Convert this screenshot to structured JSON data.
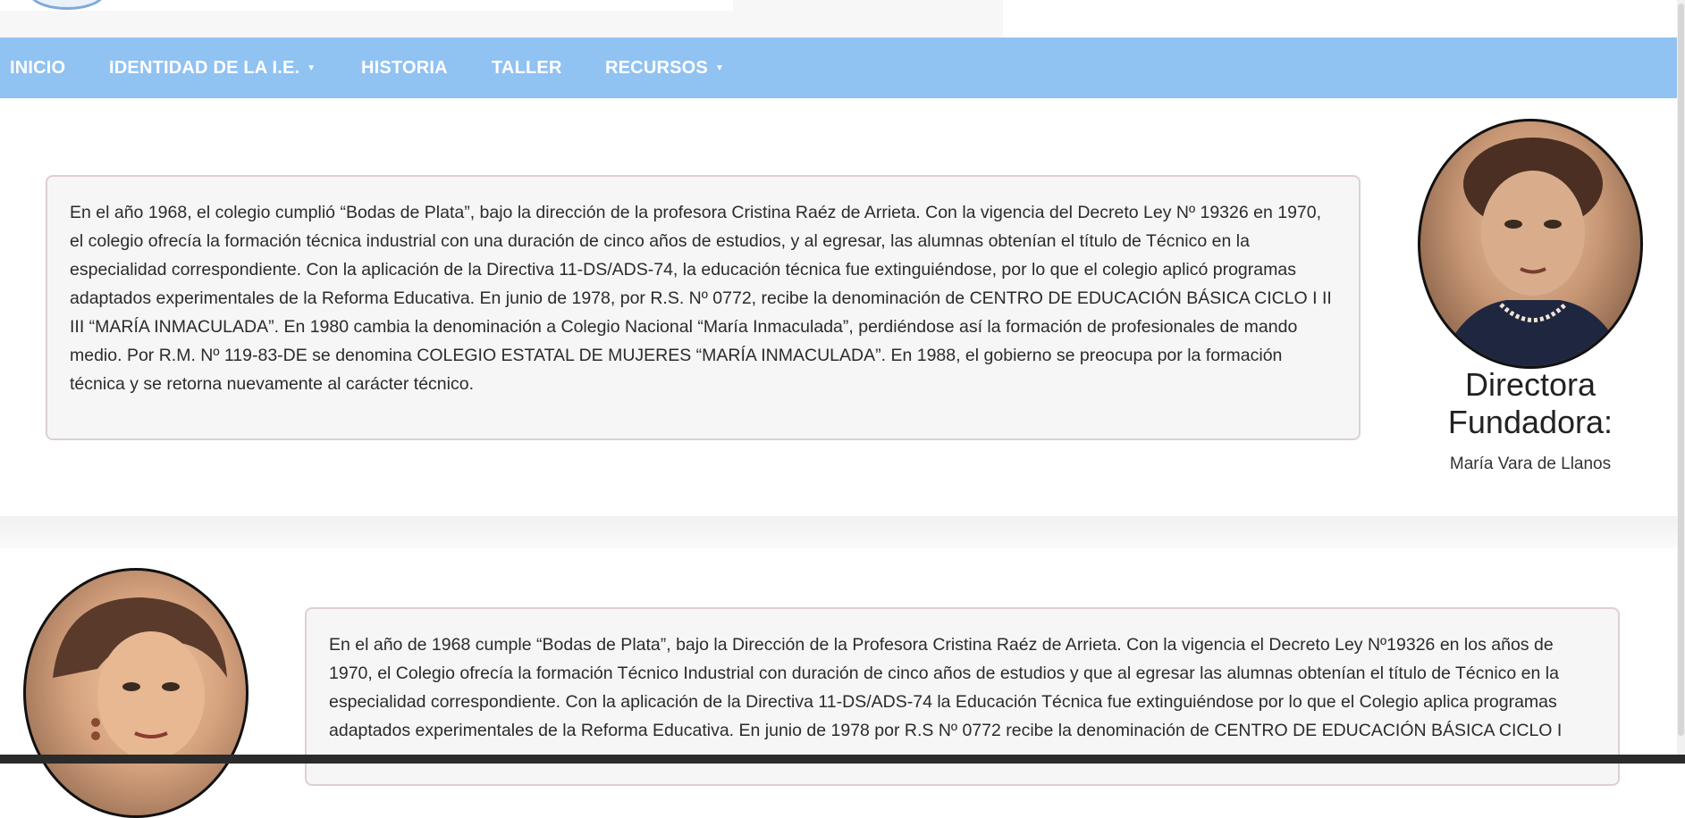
{
  "nav": {
    "items": [
      {
        "label": "INICIO"
      },
      {
        "label": "IDENTIDAD DE LA I.E."
      },
      {
        "label": "HISTORIA"
      },
      {
        "label": "TALLER"
      },
      {
        "label": "RECURSOS"
      }
    ],
    "caret": "▼"
  },
  "section1": {
    "paragraph": "En el año 1968, el colegio cumplió “Bodas de Plata”, bajo la dirección de la profesora Cristina Raéz de Arrieta. Con la vigencia del Decreto Ley Nº 19326 en 1970, el colegio ofrecía la formación técnica industrial con una duración de cinco años de estudios, y al egresar, las alumnas obtenían el título de Técnico en la especialidad correspondiente. Con la aplicación de la Directiva 11-DS/ADS-74, la educación técnica fue extinguiéndose, por lo que el colegio aplicó programas adaptados experimentales de la Reforma Educativa. En junio de 1978, por R.S. Nº 0772, recibe la denominación de CENTRO DE EDUCACIÓN BÁSICA CICLO I II III “MARÍA INMACULADA”. En 1980 cambia la denominación a Colegio Nacional “María Inmaculada”, perdiéndose así la formación de profesionales de mando medio. Por R.M. Nº 119-83-DE se denomina COLEGIO ESTATAL DE MUJERES “MARÍA INMACULADA”. En 1988, el gobierno se preocupa por la formación técnica y se retorna nuevamente al carácter técnico.",
    "portrait_title": "Directora Fundadora:",
    "portrait_name": "María Vara de Llanos"
  },
  "section2": {
    "paragraph": "En el año de 1968 cumple “Bodas de Plata”, bajo la Dirección de la Profesora Cristina Raéz de Arrieta. Con la vigencia el Decreto Ley Nº19326 en los años de 1970, el Colegio ofrecía la formación Técnico Industrial con duración de cinco años de estudios y que al egresar las alumnas obtenían el título de Técnico en la especialidad correspondiente. Con la aplicación de la Directiva 11-DS/ADS-74 la Educación Técnica fue extinguiéndose por lo que el Colegio aplica programas adaptados experimentales de la Reforma Educativa. En junio de 1978 por R.S Nº 0772 recibe la denominación de CENTRO DE EDUCACIÓN BÁSICA CICLO I"
  },
  "colors": {
    "nav_bg": "#90c2f2",
    "nav_text": "#ffffff",
    "box_bg": "#f7f6f6",
    "box_border": "#dcd0d2"
  }
}
